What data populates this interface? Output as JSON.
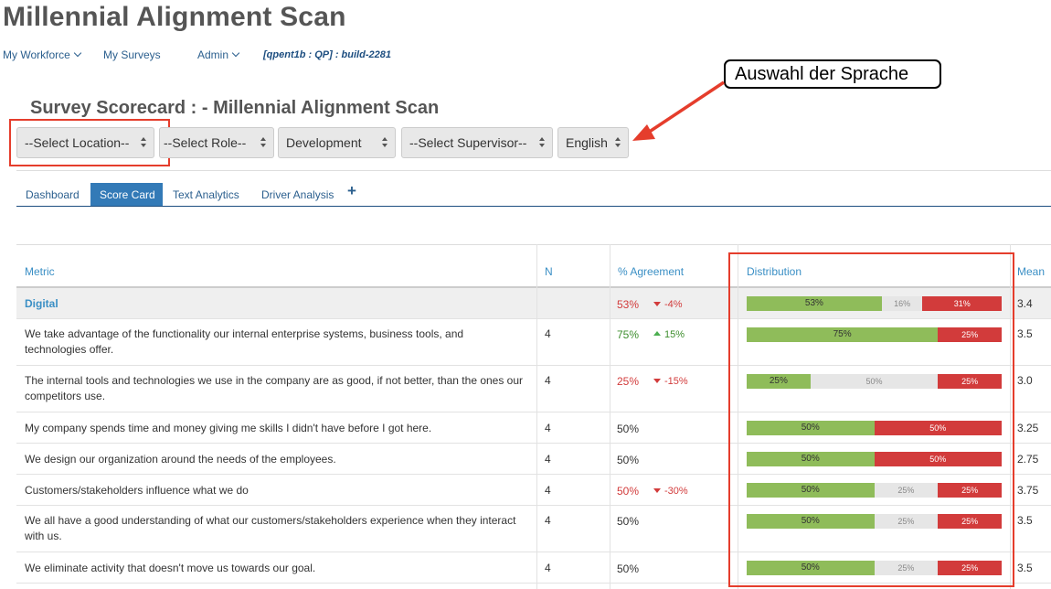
{
  "app": {
    "title": "Millennial Alignment Scan"
  },
  "nav": {
    "items": [
      {
        "label": "My Workforce",
        "dropdown": true
      },
      {
        "label": "My Surveys",
        "dropdown": false
      },
      {
        "label": "Admin",
        "dropdown": true
      }
    ],
    "build": "[qpent1b : QP] :  build-2281"
  },
  "callout": {
    "text": "Auswahl der Sprache"
  },
  "scorecard": {
    "title": "Survey Scorecard :  -  Millennial Alignment Scan"
  },
  "filters": [
    {
      "selected": "--Select Location--"
    },
    {
      "selected": "--Select Role--"
    },
    {
      "selected": "Development"
    },
    {
      "selected": "--Select Supervisor--"
    },
    {
      "selected": "English"
    }
  ],
  "tabs": [
    {
      "label": "Dashboard",
      "active": false
    },
    {
      "label": "Score Card",
      "active": true
    },
    {
      "label": "Text Analytics",
      "active": false
    },
    {
      "label": "Driver Analysis",
      "active": false
    }
  ],
  "tab_add": "+",
  "table": {
    "headers": {
      "metric": "Metric",
      "n": "N",
      "agreement": "% Agreement",
      "distribution": "Distribution",
      "mean": "Mean"
    },
    "rows": [
      {
        "metric": "Digital",
        "n": "",
        "agreement": "53%",
        "agreement_color": "red",
        "delta": "-4%",
        "delta_dir": "down",
        "dist": [
          53,
          16,
          31
        ],
        "dist_labels": [
          "53%",
          "16%",
          "31%"
        ],
        "mean": "3.4",
        "total": true
      },
      {
        "metric": "We take advantage of the functionality our internal enterprise systems, business tools, and technologies offer.",
        "n": "4",
        "agreement": "75%",
        "agreement_color": "green",
        "delta": "15%",
        "delta_dir": "up",
        "dist": [
          75,
          0,
          25
        ],
        "dist_labels": [
          "75%",
          "",
          "25%"
        ],
        "mean": "3.5"
      },
      {
        "metric": "The internal tools and technologies we use in the company are as good, if not better, than the ones our competitors use.",
        "n": "4",
        "agreement": "25%",
        "agreement_color": "red",
        "delta": "-15%",
        "delta_dir": "down",
        "dist": [
          25,
          50,
          25
        ],
        "dist_labels": [
          "25%",
          "50%",
          "25%"
        ],
        "mean": "3.0"
      },
      {
        "metric": "My company spends time and money giving me skills I didn't have before I got here.",
        "n": "4",
        "agreement": "50%",
        "agreement_color": "plain",
        "delta": "",
        "delta_dir": "",
        "dist": [
          50,
          0,
          50
        ],
        "dist_labels": [
          "50%",
          "",
          "50%"
        ],
        "mean": "3.25"
      },
      {
        "metric": "We design our organization around the needs of the employees.",
        "n": "4",
        "agreement": "50%",
        "agreement_color": "plain",
        "delta": "",
        "delta_dir": "",
        "dist": [
          50,
          0,
          50
        ],
        "dist_labels": [
          "50%",
          "",
          "50%"
        ],
        "mean": "2.75"
      },
      {
        "metric": "Customers/stakeholders influence what we do",
        "n": "4",
        "agreement": "50%",
        "agreement_color": "red",
        "delta": "-30%",
        "delta_dir": "down",
        "dist": [
          50,
          25,
          25
        ],
        "dist_labels": [
          "50%",
          "25%",
          "25%"
        ],
        "mean": "3.75"
      },
      {
        "metric": "We all have a good understanding of what our customers/stakeholders experience when they interact with us.",
        "n": "4",
        "agreement": "50%",
        "agreement_color": "plain",
        "delta": "",
        "delta_dir": "",
        "dist": [
          50,
          25,
          25
        ],
        "dist_labels": [
          "50%",
          "25%",
          "25%"
        ],
        "mean": "3.5"
      },
      {
        "metric": "We eliminate activity that doesn't move us towards our goal.",
        "n": "4",
        "agreement": "50%",
        "agreement_color": "plain",
        "delta": "",
        "delta_dir": "",
        "dist": [
          50,
          25,
          25
        ],
        "dist_labels": [
          "50%",
          "25%",
          "25%"
        ],
        "mean": "3.5"
      }
    ]
  },
  "colors": {
    "accent": "#337ab7",
    "link": "#2b5f8e",
    "positive": "#8fbc5a",
    "negative": "#d23b3b",
    "neutral": "#e6e6e6",
    "highlight": "#e53d2c"
  }
}
